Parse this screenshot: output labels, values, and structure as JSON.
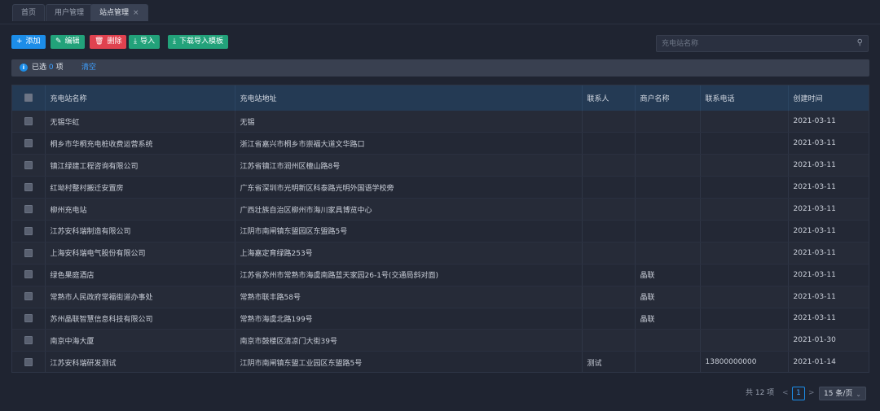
{
  "tabs": [
    {
      "label": "首页"
    },
    {
      "label": "用户管理"
    },
    {
      "label": "站点管理",
      "close": "×"
    }
  ],
  "toolbar": {
    "add": {
      "icon": "+",
      "label": "添加"
    },
    "edit": {
      "icon": "✎",
      "label": "编辑"
    },
    "delete": {
      "icon": "🗑",
      "label": "删除"
    },
    "import": {
      "icon": "⤓",
      "label": "导入"
    },
    "download_template": {
      "icon": "⤓",
      "label": "下载导入模板"
    }
  },
  "search": {
    "placeholder": "充电站名称",
    "icon": "search-icon",
    "value": ""
  },
  "selection": {
    "prefix": "已选",
    "count": "0",
    "suffix": "项",
    "clear_label": "清空"
  },
  "table": {
    "columns": [
      "充电站名称",
      "充电站地址",
      "联系人",
      "商户名称",
      "联系电话",
      "创建时间"
    ],
    "rows": [
      [
        "无锡华虹",
        "无锡",
        "",
        "",
        "",
        "2021-03-11"
      ],
      [
        "桐乡市华桐充电桩收费运营系统",
        "浙江省嘉兴市桐乡市崇福大道文华路口",
        "",
        "",
        "",
        "2021-03-11"
      ],
      [
        "镇江绿建工程咨询有限公司",
        "江苏省镇江市润州区檀山路8号",
        "",
        "",
        "",
        "2021-03-11"
      ],
      [
        "红坳村整村搬迁安置房",
        "广东省深圳市光明新区科泰路光明外国语学校旁",
        "",
        "",
        "",
        "2021-03-11"
      ],
      [
        "柳州充电站",
        "广西壮族自治区柳州市海川家具博览中心",
        "",
        "",
        "",
        "2021-03-11"
      ],
      [
        "江苏安科瑞制造有限公司",
        "江阴市南闸镇东盟园区东盟路5号",
        "",
        "",
        "",
        "2021-03-11"
      ],
      [
        "上海安科瑞电气股份有限公司",
        "上海嘉定育绿路253号",
        "",
        "",
        "",
        "2021-03-11"
      ],
      [
        "绿色果庭酒店",
        "江苏省苏州市常熟市海虞南路蓝天家园26-1号(交通局斜对面)",
        "",
        "晶联",
        "",
        "2021-03-11"
      ],
      [
        "常熟市人民政府常福街道办事处",
        "常熟市联丰路58号",
        "",
        "晶联",
        "",
        "2021-03-11"
      ],
      [
        "苏州晶联智慧信息科技有限公司",
        "常熟市海虞北路199号",
        "",
        "晶联",
        "",
        "2021-03-11"
      ],
      [
        "南京中海大厦",
        "南京市鼓楼区清凉门大街39号",
        "",
        "",
        "",
        "2021-01-30"
      ],
      [
        "江苏安科瑞研发测试",
        "江阴市南闸镇东盟工业园区东盟路5号",
        "测试",
        "",
        "13800000000",
        "2021-01-14"
      ]
    ]
  },
  "pagination": {
    "total_label": "共 12 项",
    "prev": "<",
    "current_page": "1",
    "next": ">",
    "page_size_label": "15 条/页",
    "chevron": "⌄"
  },
  "colors": {
    "primary": "#1c8de8",
    "success": "#22a27a",
    "danger": "#e0424f",
    "background": "#1f2431"
  }
}
